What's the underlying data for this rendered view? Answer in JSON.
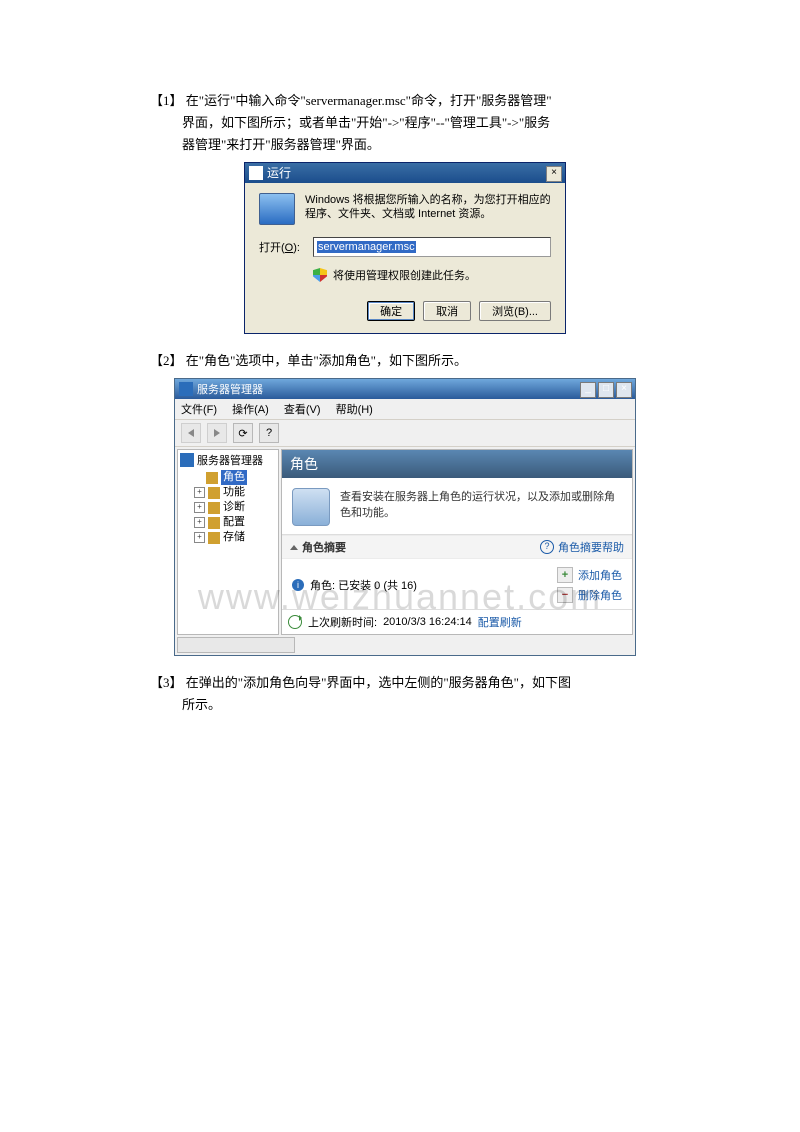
{
  "steps": {
    "s1": {
      "num": "【1】",
      "text_a": "  在\"运行\"中输入命令\"servermanager.msc\"命令，打开\"服务器管理\"",
      "text_b": "界面，如下图所示；或者单击\"开始\"->\"程序\"--\"管理工具\"->\"服务",
      "text_c": "器管理\"来打开\"服务器管理\"界面。"
    },
    "s2": {
      "num": "【2】",
      "text": "  在\"角色\"选项中，单击\"添加角色\"，如下图所示。"
    },
    "s3": {
      "num": "【3】",
      "text_a": "  在弹出的\"添加角色向导\"界面中，选中左侧的\"服务器角色\"，如下图",
      "text_b": "所示。"
    }
  },
  "run": {
    "title": "运行",
    "desc": "Windows 将根据您所输入的名称，为您打开相应的程序、文件夹、文档或 Internet 资源。",
    "open_label_prefix": "打开(",
    "open_label_key": "O",
    "open_label_suffix": "):",
    "input_value": "servermanager.msc",
    "shield_note": "将使用管理权限创建此任务。",
    "btn_ok": "确定",
    "btn_cancel": "取消",
    "btn_browse": "浏览(B)...",
    "close": "×"
  },
  "sm": {
    "title": "服务器管理器",
    "menu": {
      "file": "文件(F)",
      "action": "操作(A)",
      "view": "查看(V)",
      "help": "帮助(H)"
    },
    "ctl": {
      "min": "_",
      "max": "□",
      "close": "×"
    },
    "tree": {
      "root": "服务器管理器",
      "items": [
        {
          "label": "角色",
          "sel": true,
          "pm": ""
        },
        {
          "label": "功能",
          "pm": "+"
        },
        {
          "label": "诊断",
          "pm": "+"
        },
        {
          "label": "配置",
          "pm": "+"
        },
        {
          "label": "存储",
          "pm": "+"
        }
      ]
    },
    "right": {
      "header": "角色",
      "desc": "查看安装在服务器上角色的运行状况，以及添加或删除角色和功能。",
      "summary_title": "角色摘要",
      "help_link": "角色摘要帮助",
      "roles_label": "角色: 已安装 0 (共 16)",
      "add_role": "添加角色",
      "del_role": "删除角色",
      "status_time_prefix": "上次刷新时间: ",
      "status_time": "2010/3/3 16:24:14",
      "status_refresh": "配置刷新"
    }
  },
  "watermark": "www.weizhuannet.com"
}
